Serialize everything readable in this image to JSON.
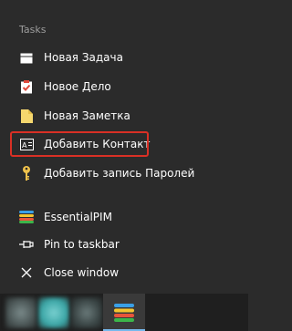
{
  "jumplist": {
    "section_title": "Tasks",
    "tasks": [
      {
        "label": "Новая Задача",
        "icon": "calendar-icon"
      },
      {
        "label": "Новое Дело",
        "icon": "todo-clipboard-icon"
      },
      {
        "label": "Новая Заметка",
        "icon": "note-icon"
      },
      {
        "label": "Добавить Контакт",
        "icon": "contact-card-icon"
      },
      {
        "label": "Добавить запись Паролей",
        "icon": "key-icon"
      }
    ],
    "app": {
      "label": "EssentialPIM",
      "icon": "essentialpim-logo-icon"
    },
    "pin": {
      "label": "Pin to taskbar",
      "icon": "pin-icon"
    },
    "close": {
      "label": "Close window",
      "icon": "close-icon"
    }
  },
  "colors": {
    "background": "#2b2b2b",
    "highlight_border": "#d93025",
    "accent_underline": "#76b9ed",
    "header_text": "#9d9d9d"
  }
}
